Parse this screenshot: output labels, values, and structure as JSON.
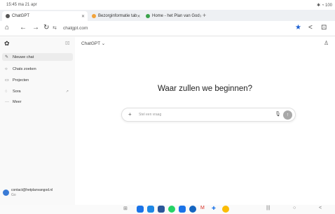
{
  "status": {
    "time": "15:45 ma 21 apr",
    "icons": "✱ ◔ 100"
  },
  "tabs": [
    {
      "title": "ChatGPT",
      "fav_color": "#555555"
    },
    {
      "title": "Bezorginformatie tab",
      "fav_color": "#f2a33a"
    },
    {
      "title": "Home - het Plan van God",
      "fav_color": "#3aa24a"
    }
  ],
  "url": "chatgpt.com",
  "sidebar": {
    "items": [
      {
        "label": "Nieuwe chat",
        "icon": "edit-icon"
      },
      {
        "label": "Chats zoeken",
        "icon": "search-icon"
      },
      {
        "label": "Projecten",
        "icon": "folder-icon"
      },
      {
        "label": "Sora",
        "icon": "sora-icon"
      },
      {
        "label": "Meer",
        "icon": "more-icon"
      }
    ],
    "account": {
      "email": "contact@hetplanvangod.nl",
      "sub": "Go"
    }
  },
  "main": {
    "model_label": "ChatGPT ⌄",
    "heading": "Waar zullen we beginnen?",
    "prompt_placeholder": "Stel een vraag"
  }
}
